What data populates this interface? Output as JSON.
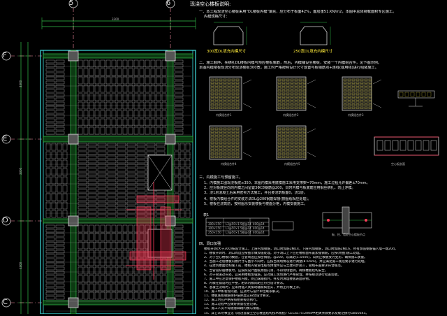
{
  "plan": {
    "grid_top": [
      "5",
      "6"
    ],
    "grid_left": [
      "F",
      "E",
      "D",
      "C"
    ],
    "dim_top": "3300",
    "dim_left": [
      "3300",
      "3300",
      "4300"
    ]
  },
  "notes": {
    "title": "现浇空心楼板说明:",
    "p1": "一、本工程现浇空心楼板采用\"DL楼板内模\"填充，应分布于板面42%，面层重51.KN/m2，本图中总体荷载面积专区施工。",
    "p1b": "内模规格尺寸：",
    "section_labels": [
      "300宽DL填充内模尺寸",
      "250宽DL填充内模尺寸"
    ],
    "p2": "二、施工顺序，先绑扎DL楼板内模与预应楼板底筋，然后，内模铺设至楼板，安装一个内模组合件，见下图示例。",
    "p2b": "本图内模楼板现浇分布现浇楼板300宽，施工时严格按照设计尺寸放置与板钢筋点+连线(或用线)进行组装施工。",
    "sub_captions": [
      "内模组合件1",
      "内模组合件2",
      "内模组合件3",
      "内模组合件4",
      "内模组合件5"
    ],
    "detail_caption": "空心板剖面",
    "p3": "三、内模施工与预留施工。",
    "p3_items": [
      "1、内模施工图现浇板底≥350，本图内模采用底模施工采用支撑架=70mm，施工过程允许偏差±70mm。",
      "2、应对板底竖向的内模之间留置3ΦC8钢筋@200，同时内模与板底筋应用钢丝绑扎，防止浮模。",
      "3、浇1层混凝土后采用密实方法施工，并且要浇筑板面0，浇1层。"
    ],
    "p4_a": "4、楼板内模组合件的安装方法DL@200钢筋焊接(按图纸相应处理)。",
    "p4_b": "5、楼板在浇筑前，按照图示安装楼板与楼面分格，内模安装施工。",
    "table_title": "表1",
    "table_rows": [
      [
        "300×150",
        "L3@50×1.5根@14",
        "400@14"
      ],
      [
        "300×150",
        "L3@50×1.5根@14",
        "400@14"
      ],
      [
        "250×150",
        "L3@50×1.5根@14",
        "400@14"
      ]
    ],
    "table_caption": "板、柱、墙处空心楼板节点",
    "section4": "四、洞口加强",
    "section4_items": [
      "楼板开洞(大于300)按设计施工，上层内加钢筋，洞口附加筋2根14，下层内加钢筋，洞口附加筋2根16，所有加强钢筋锚入墙一端20d。",
      "1、楼板开洞时，洞口周边应按图示做加强处理，对于洞口上下应在楼板面布置加强钢筋，应按(附图)施工处理。",
      "2、对于空心楼板内模管，在管周边应加密钢筋，@200，以满足(1.5mm)，以防止模板受力变形，确保施工质量。",
      "3、当施工过程楼板内模尺寸与图示不同时，应按当现场情况进行调整(8.5mm)，并应满足施工规范要求进行处理。",
      "4、在建筑楼面结构施工前，楼板内管道电缆等预埋件应与土建同步施工，管线布置要求符合规范。",
      "5、当管道穿越楼板时，应按照设计图纸预留孔洞，不得现场凿洞，确保楼板结构安全。",
      "6、对于管道过长处，宜采用楼板加强筋，应对施工现场进行严格管理，并按规范进行检查验收。",
      "7、施工中应注意保护楼板内模，防止踩踏损坏，并及时清理楼板表面杂物。",
      "8、内模在铺设时应平整，相邻内模间距应符合设计要求。",
      "9、混凝土浇筑时，应采用插入式振动器振捣密实，并防止内模上浮。",
      "10、施工中如发现问题，应及时与设计单位联系解决。",
      "11、楼板底板钢筋保护层厚度应符合设计要求。",
      "12、施工时应严格按照相关规范执行。",
      "13、施工过程中应做好质量检查记录。",
      "14、施工人员不得随意踩踏内模与钢筋。",
      "15、其它未尽事宜见《现浇混凝土空心楼盖结构技术规程》CECS175:2004中相关条款要求及规范执行GB50343。"
    ]
  }
}
